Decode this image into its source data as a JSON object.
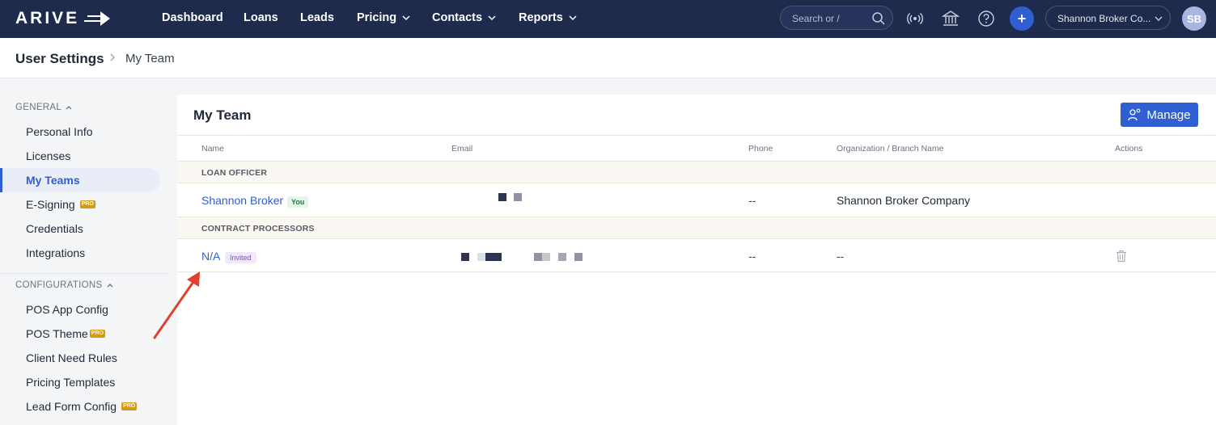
{
  "nav": {
    "logo": "ARIVE",
    "items": [
      {
        "label": "Dashboard",
        "dropdown": false
      },
      {
        "label": "Loans",
        "dropdown": false
      },
      {
        "label": "Leads",
        "dropdown": false
      },
      {
        "label": "Pricing",
        "dropdown": true
      },
      {
        "label": "Contacts",
        "dropdown": true
      },
      {
        "label": "Reports",
        "dropdown": true
      }
    ],
    "search_placeholder": "Search or /",
    "org_name": "Shannon Broker Co...",
    "avatar_initials": "SB",
    "plus": "+"
  },
  "breadcrumb": {
    "root": "User Settings",
    "current": "My Team"
  },
  "sidebar": {
    "general_label": "GENERAL",
    "general_items": [
      {
        "label": "Personal Info",
        "pro": false,
        "active": false
      },
      {
        "label": "Licenses",
        "pro": false,
        "active": false
      },
      {
        "label": "My Teams",
        "pro": false,
        "active": true
      },
      {
        "label": "E-Signing",
        "pro": true,
        "active": false
      },
      {
        "label": "Credentials",
        "pro": false,
        "active": false
      },
      {
        "label": "Integrations",
        "pro": false,
        "active": false
      }
    ],
    "config_label": "CONFIGURATIONS",
    "config_items": [
      {
        "label": "POS App Config",
        "pro": false
      },
      {
        "label": "POS Theme",
        "pro": true
      },
      {
        "label": "Client Need Rules",
        "pro": false
      },
      {
        "label": "Pricing Templates",
        "pro": false
      },
      {
        "label": "Lead Form Config",
        "pro": true
      }
    ],
    "pro_label": "PRO"
  },
  "team": {
    "title": "My Team",
    "manage_label": "Manage",
    "columns": [
      "Name",
      "Email",
      "Phone",
      "Organization / Branch Name",
      "Actions"
    ],
    "groups": [
      {
        "label": "LOAN OFFICER",
        "rows": [
          {
            "name": "Shannon Broker",
            "badge": "You",
            "phone": "--",
            "org": "Shannon Broker Company",
            "deletable": false
          }
        ]
      },
      {
        "label": "CONTRACT PROCESSORS",
        "rows": [
          {
            "name": "N/A",
            "badge": "Invited",
            "phone": "--",
            "org": "--",
            "deletable": true
          }
        ]
      }
    ]
  },
  "colors": {
    "nav_bg": "#1f2b4d",
    "accent": "#2f5fd0",
    "pro_badge": "#d49a16",
    "annotation_arrow": "#e0412f"
  }
}
